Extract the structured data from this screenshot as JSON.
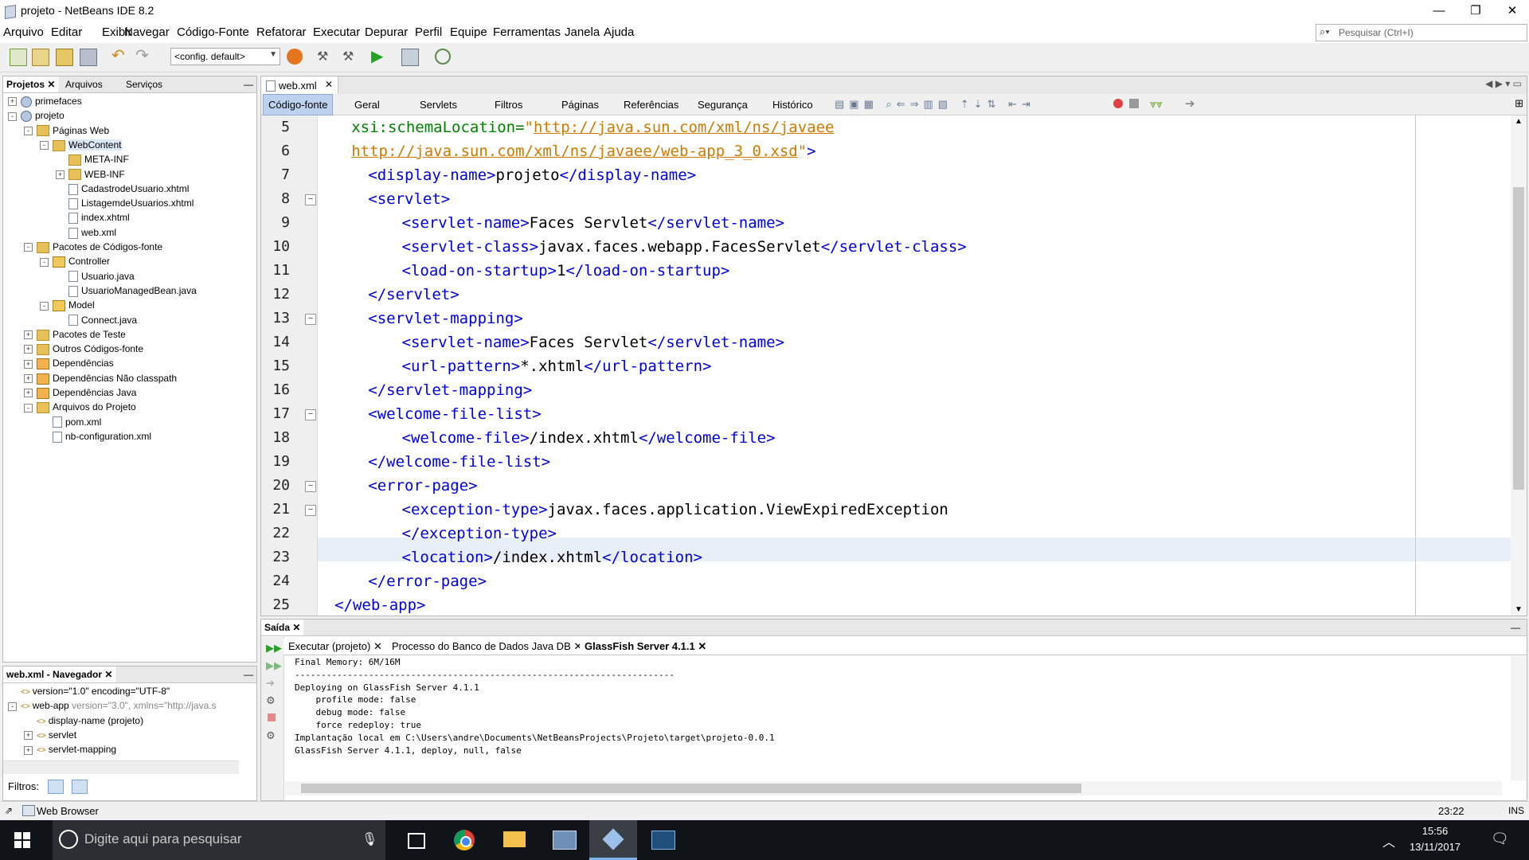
{
  "window": {
    "title": "projeto - NetBeans IDE 8.2"
  },
  "menu": [
    "Arquivo",
    "Editar",
    "Exibir",
    "Navegar",
    "Código-Fonte",
    "Refatorar",
    "Executar",
    "Depurar",
    "Perfil",
    "Equipe",
    "Ferramentas",
    "Janela",
    "Ajuda"
  ],
  "search": {
    "placeholder": "Pesquisar (Ctrl+I)"
  },
  "toolbar": {
    "config": "<config. default>"
  },
  "left_tabs": [
    "Projetos",
    "Arquivos",
    "Serviços"
  ],
  "tree": [
    {
      "label": "primefaces",
      "level": 0,
      "icon": "proj",
      "exp": "+"
    },
    {
      "label": "projeto",
      "level": 0,
      "icon": "proj",
      "exp": "-"
    },
    {
      "label": "Páginas Web",
      "level": 1,
      "icon": "folder",
      "exp": "-"
    },
    {
      "label": "WebContent",
      "level": 2,
      "icon": "folder",
      "exp": "-",
      "selected": true
    },
    {
      "label": "META-INF",
      "level": 3,
      "icon": "folder",
      "exp": ""
    },
    {
      "label": "WEB-INF",
      "level": 3,
      "icon": "folder",
      "exp": "+"
    },
    {
      "label": "CadastrodeUsuario.xhtml",
      "level": 3,
      "icon": "file",
      "exp": ""
    },
    {
      "label": "ListagemdeUsuarios.xhtml",
      "level": 3,
      "icon": "file",
      "exp": ""
    },
    {
      "label": "index.xhtml",
      "level": 3,
      "icon": "file",
      "exp": ""
    },
    {
      "label": "web.xml",
      "level": 3,
      "icon": "file",
      "exp": ""
    },
    {
      "label": "Pacotes de Códigos-fonte",
      "level": 1,
      "icon": "folder",
      "exp": "-"
    },
    {
      "label": "Controller",
      "level": 2,
      "icon": "pkg",
      "exp": "-"
    },
    {
      "label": "Usuario.java",
      "level": 3,
      "icon": "java",
      "exp": ""
    },
    {
      "label": "UsuarioManagedBean.java",
      "level": 3,
      "icon": "java",
      "exp": ""
    },
    {
      "label": "Model",
      "level": 2,
      "icon": "pkg",
      "exp": "-"
    },
    {
      "label": "Connect.java",
      "level": 3,
      "icon": "java",
      "exp": ""
    },
    {
      "label": "Pacotes de Teste",
      "level": 1,
      "icon": "folder",
      "exp": "+"
    },
    {
      "label": "Outros Códigos-fonte",
      "level": 1,
      "icon": "folder",
      "exp": "+"
    },
    {
      "label": "Dependências",
      "level": 1,
      "icon": "lib",
      "exp": "+"
    },
    {
      "label": "Dependências Não classpath",
      "level": 1,
      "icon": "lib",
      "exp": "+"
    },
    {
      "label": "Dependências Java",
      "level": 1,
      "icon": "lib",
      "exp": "+"
    },
    {
      "label": "Arquivos do Projeto",
      "level": 1,
      "icon": "folder",
      "exp": "-"
    },
    {
      "label": "pom.xml",
      "level": 2,
      "icon": "file",
      "exp": ""
    },
    {
      "label": "nb-configuration.xml",
      "level": 2,
      "icon": "file",
      "exp": ""
    }
  ],
  "navigator": {
    "title": "web.xml - Navegador",
    "rows": [
      {
        "label": "version=\"1.0\" encoding=\"UTF-8\"",
        "level": 0,
        "exp": ""
      },
      {
        "label": "web-app",
        "extra": " version=\"3.0\", xmlns=\"http://java.s",
        "level": 0,
        "exp": "-"
      },
      {
        "label": "display-name (projeto)",
        "level": 1,
        "exp": ""
      },
      {
        "label": "servlet",
        "level": 1,
        "exp": "+"
      },
      {
        "label": "servlet-mapping",
        "level": 1,
        "exp": "+"
      }
    ],
    "filters_label": "Filtros:"
  },
  "editor": {
    "tab": "web.xml",
    "subtabs": [
      "Código-fonte",
      "Geral",
      "Servlets",
      "Filtros",
      "Páginas",
      "Referências",
      "Segurança",
      "Histórico"
    ],
    "lines": [
      {
        "n": "5",
        "indent": 2,
        "parts": [
          [
            "attr",
            "xsi:schemaLocation="
          ],
          [
            "str",
            "\""
          ],
          [
            "url",
            "http://java.sun.com/xml/ns/javaee"
          ]
        ]
      },
      {
        "n": "6",
        "indent": 2,
        "parts": [
          [
            "url",
            "http://java.sun.com/xml/ns/javaee/web-app_3_0.xsd"
          ],
          [
            "str",
            "\""
          ],
          [
            "tag",
            ">"
          ]
        ]
      },
      {
        "n": "7",
        "indent": 3,
        "parts": [
          [
            "tag",
            "<display-name>"
          ],
          [
            "txt",
            "projeto"
          ],
          [
            "tag",
            "</display-name>"
          ]
        ]
      },
      {
        "n": "8",
        "indent": 3,
        "fold": true,
        "parts": [
          [
            "tag",
            "<servlet>"
          ]
        ]
      },
      {
        "n": "9",
        "indent": 5,
        "parts": [
          [
            "tag",
            "<servlet-name>"
          ],
          [
            "txt",
            "Faces Servlet"
          ],
          [
            "tag",
            "</servlet-name>"
          ]
        ]
      },
      {
        "n": "10",
        "indent": 5,
        "parts": [
          [
            "tag",
            "<servlet-class>"
          ],
          [
            "txt",
            "javax.faces.webapp.FacesServlet"
          ],
          [
            "tag",
            "</servlet-class>"
          ]
        ]
      },
      {
        "n": "11",
        "indent": 5,
        "parts": [
          [
            "tag",
            "<load-on-startup>"
          ],
          [
            "txt",
            "1"
          ],
          [
            "tag",
            "</load-on-startup>"
          ]
        ]
      },
      {
        "n": "12",
        "indent": 3,
        "parts": [
          [
            "tag",
            "</servlet>"
          ]
        ]
      },
      {
        "n": "13",
        "indent": 3,
        "fold": true,
        "parts": [
          [
            "tag",
            "<servlet-mapping>"
          ]
        ]
      },
      {
        "n": "14",
        "indent": 5,
        "parts": [
          [
            "tag",
            "<servlet-name>"
          ],
          [
            "txt",
            "Faces Servlet"
          ],
          [
            "tag",
            "</servlet-name>"
          ]
        ]
      },
      {
        "n": "15",
        "indent": 5,
        "parts": [
          [
            "tag",
            "<url-pattern>"
          ],
          [
            "txt",
            "*.xhtml"
          ],
          [
            "tag",
            "</url-pattern>"
          ]
        ]
      },
      {
        "n": "16",
        "indent": 3,
        "parts": [
          [
            "tag",
            "</servlet-mapping>"
          ]
        ]
      },
      {
        "n": "17",
        "indent": 3,
        "fold": true,
        "parts": [
          [
            "tag",
            "<welcome-file-list>"
          ]
        ]
      },
      {
        "n": "18",
        "indent": 5,
        "parts": [
          [
            "tag",
            "<welcome-file>"
          ],
          [
            "txt",
            "/index.xhtml"
          ],
          [
            "tag",
            "</welcome-file>"
          ]
        ]
      },
      {
        "n": "19",
        "indent": 3,
        "parts": [
          [
            "tag",
            "</welcome-file-list>"
          ]
        ]
      },
      {
        "n": "20",
        "indent": 3,
        "fold": true,
        "parts": [
          [
            "tag",
            "<error-page>"
          ]
        ]
      },
      {
        "n": "21",
        "indent": 5,
        "fold": true,
        "parts": [
          [
            "tag",
            "<exception-type>"
          ],
          [
            "txt",
            "javax.faces.application.ViewExpiredException"
          ]
        ]
      },
      {
        "n": "22",
        "indent": 5,
        "parts": [
          [
            "tag",
            "</exception-type>"
          ]
        ]
      },
      {
        "n": "23",
        "indent": 5,
        "parts": [
          [
            "tag",
            "<location>"
          ],
          [
            "txt",
            "/index.xhtml"
          ],
          [
            "tag",
            "</location>"
          ]
        ]
      },
      {
        "n": "24",
        "indent": 3,
        "parts": [
          [
            "tag",
            "</error-page>"
          ]
        ]
      },
      {
        "n": "25",
        "indent": 1,
        "parts": [
          [
            "tag",
            "</web-app>"
          ]
        ]
      }
    ]
  },
  "output": {
    "title": "Saída",
    "tabs": [
      "Executar (projeto)",
      "Processo do Banco de Dados Java DB",
      "GlassFish Server 4.1.1"
    ],
    "lines": [
      "Final Memory: 6M/16M",
      "------------------------------------------------------------------------",
      "Deploying on GlassFish Server 4.1.1",
      "    profile mode: false",
      "    debug mode: false",
      "    force redeploy: true",
      "Implantação local em C:\\Users\\andre\\Documents\\NetBeansProjects\\Projeto\\target\\projeto-0.0.1",
      "GlassFish Server 4.1.1, deploy, null, false"
    ]
  },
  "status": {
    "left": "Web Browser",
    "position": "23:22",
    "mode": "INS"
  },
  "taskbar": {
    "search_placeholder": "Digite aqui para pesquisar",
    "time": "15:56",
    "date": "13/11/2017"
  },
  "colors": {
    "tag": "#0000e6",
    "attr": "#008200",
    "string": "#ce7b00"
  }
}
